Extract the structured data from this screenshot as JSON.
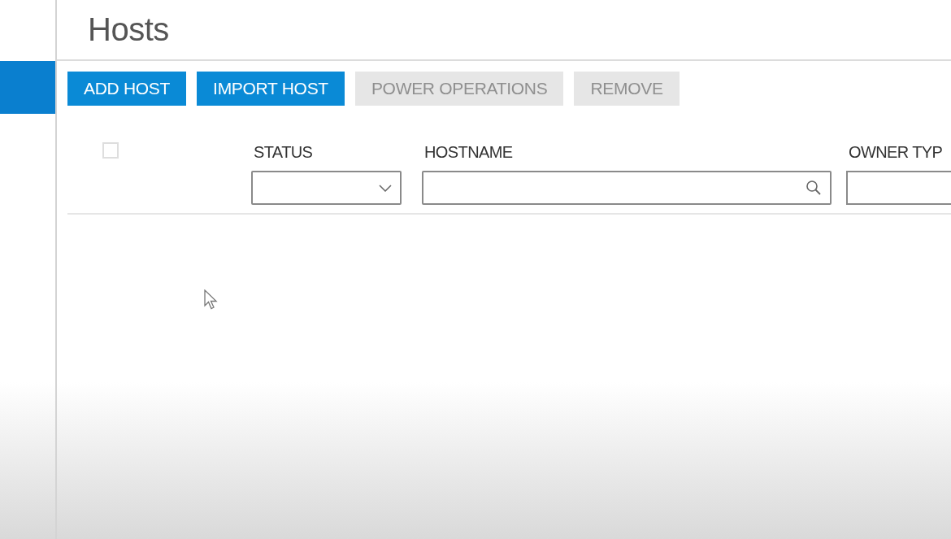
{
  "sidebar": {
    "items": [
      {
        "selected": true
      }
    ]
  },
  "page": {
    "title": "Hosts"
  },
  "toolbar": {
    "buttons": [
      {
        "label": "ADD HOST",
        "disabled": false
      },
      {
        "label": "IMPORT HOST",
        "disabled": false
      },
      {
        "label": "POWER OPERATIONS",
        "disabled": true
      },
      {
        "label": "REMOVE",
        "disabled": true
      }
    ]
  },
  "table": {
    "select_all": {
      "checked": false
    },
    "columns": [
      {
        "label": "STATUS",
        "filter": {
          "kind": "select"
        }
      },
      {
        "label": "HOSTNAME",
        "filter": {
          "kind": "search"
        }
      },
      {
        "label": "OWNER TYP",
        "filter": {
          "kind": "text"
        }
      }
    ]
  }
}
